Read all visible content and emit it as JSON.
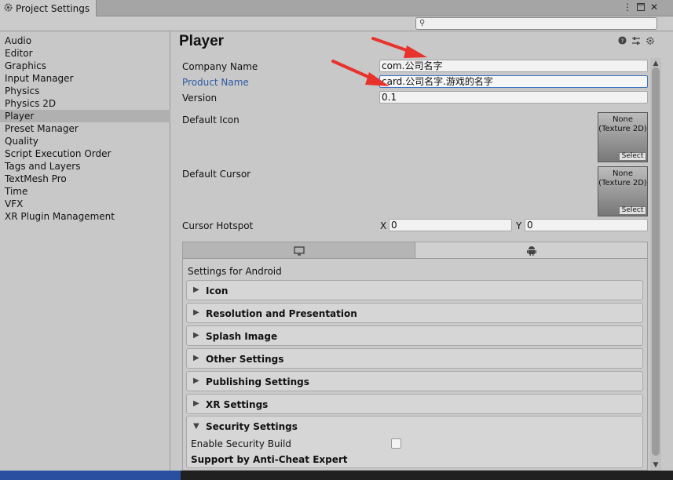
{
  "window": {
    "title": "Project Settings",
    "menu_icon": "kebab-menu-icon",
    "maximize_icon": "maximize-icon",
    "close_icon": "close-icon"
  },
  "search": {
    "placeholder": "",
    "icon": "search-icon"
  },
  "sidebar": {
    "items": [
      {
        "label": "Audio"
      },
      {
        "label": "Editor"
      },
      {
        "label": "Graphics"
      },
      {
        "label": "Input Manager"
      },
      {
        "label": "Physics"
      },
      {
        "label": "Physics 2D"
      },
      {
        "label": "Player"
      },
      {
        "label": "Preset Manager"
      },
      {
        "label": "Quality"
      },
      {
        "label": "Script Execution Order"
      },
      {
        "label": "Tags and Layers"
      },
      {
        "label": "TextMesh Pro"
      },
      {
        "label": "Time"
      },
      {
        "label": "VFX"
      },
      {
        "label": "XR Plugin Management"
      }
    ],
    "selected": "Player"
  },
  "player": {
    "title": "Player",
    "company_label": "Company Name",
    "company_value": "com.公司名字",
    "product_label": "Product Name",
    "product_value": "card.公司名字.游戏的名字",
    "version_label": "Version",
    "version_value": "0.1",
    "default_icon_label": "Default Icon",
    "default_cursor_label": "Default Cursor",
    "object_field_text": "None\n(Texture 2D)",
    "object_field_line1": "None",
    "object_field_line2": "(Texture 2D)",
    "select_label": "Select",
    "hotspot_label": "Cursor Hotspot",
    "hotspot_x_label": "X",
    "hotspot_x_value": "0",
    "hotspot_y_label": "Y",
    "hotspot_y_value": "0"
  },
  "platform": {
    "title": "Settings for Android",
    "tabs": [
      "standalone",
      "android"
    ],
    "sections": [
      {
        "label": "Icon"
      },
      {
        "label": "Resolution and Presentation"
      },
      {
        "label": "Splash Image"
      },
      {
        "label": "Other Settings"
      },
      {
        "label": "Publishing Settings"
      },
      {
        "label": "XR Settings"
      }
    ],
    "security": {
      "label": "Security Settings",
      "enable_label": "Enable Security Build",
      "enable_checked": false,
      "sub_label": "Support by Anti-Cheat Expert"
    }
  },
  "annotation_color": "#e8322c"
}
